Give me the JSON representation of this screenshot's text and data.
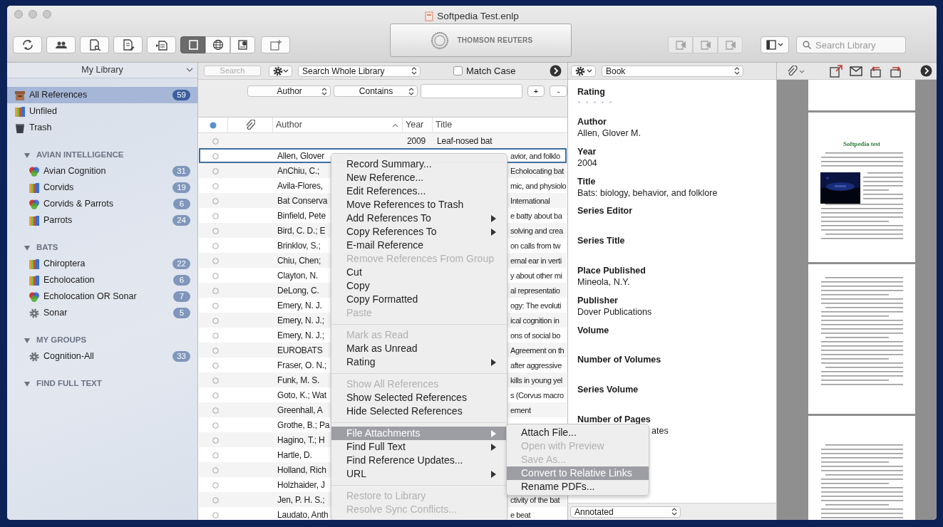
{
  "window": {
    "title": "Softpedia Test.enlp"
  },
  "toolbar": {
    "layout_modes": [
      {
        "selected": true
      },
      {
        "selected": false
      },
      {
        "selected": false
      }
    ],
    "sync_group": {
      "disabled": true
    },
    "logo": "THOMSON REUTERS",
    "search": {
      "placeholder": "Search Library"
    }
  },
  "sidebar": {
    "header": "My Library",
    "items": [
      {
        "label": "All References",
        "count": "59",
        "kind": "archive",
        "selected": true
      },
      {
        "label": "Unfiled",
        "kind": "books",
        "selected": false
      },
      {
        "label": "Trash",
        "kind": "trash",
        "selected": false
      }
    ],
    "sections": [
      {
        "title": "AVIAN INTELLIGENCE",
        "expanded": true,
        "items": [
          {
            "label": "Avian Cognition",
            "count": "31",
            "kind": "smart",
            "selected": false
          },
          {
            "label": "Corvids",
            "count": "19",
            "kind": "books",
            "selected": false
          },
          {
            "label": "Corvids & Parrots",
            "count": "6",
            "kind": "smart",
            "selected": false
          },
          {
            "label": "Parrots",
            "count": "24",
            "kind": "books",
            "selected": false
          }
        ]
      },
      {
        "title": "BATS",
        "expanded": true,
        "items": [
          {
            "label": "Chiroptera",
            "count": "22",
            "kind": "books",
            "selected": false
          },
          {
            "label": "Echolocation",
            "count": "6",
            "kind": "books",
            "selected": false
          },
          {
            "label": "Echolocation OR Sonar",
            "count": "7",
            "kind": "smart",
            "selected": false
          },
          {
            "label": "Sonar",
            "count": "5",
            "kind": "gear",
            "selected": false
          }
        ]
      },
      {
        "title": "MY GROUPS",
        "expanded": true,
        "items": [
          {
            "label": "Cognition-All",
            "count": "33",
            "kind": "gear",
            "selected": false
          }
        ]
      },
      {
        "title": "FIND FULL TEXT",
        "expanded": true
      }
    ]
  },
  "search_panel": {
    "search": {
      "placeholder": "Search"
    },
    "scope": "Search Whole Library",
    "match_case": {
      "label": "Match Case",
      "checked": false
    },
    "filter": {
      "field": "Author",
      "operator": "Contains",
      "add": "+",
      "remove": "-"
    }
  },
  "table": {
    "columns": [
      "Author",
      "Year",
      "Title"
    ],
    "rows": [
      {
        "author": "",
        "year": "2009",
        "title": "Leaf-nosed bat",
        "unread": false,
        "selected": false
      },
      {
        "author": "Allen, Glover",
        "title": "avior, and folklo",
        "unread": false,
        "selected": true
      },
      {
        "author": "AnChiu, C.;",
        "title": "Echolocating bat",
        "unread": false,
        "selected": false
      },
      {
        "author": "Avila-Flores,",
        "title": "mic, and physiolo",
        "unread": false,
        "selected": false
      },
      {
        "author": "Bat Conserva",
        "title": "International",
        "unread": false,
        "selected": false
      },
      {
        "author": "Binfield, Pete",
        "title": "e batty about ba",
        "unread": false,
        "selected": false
      },
      {
        "author": "Bird, C. D.; E",
        "title": "solving and crea",
        "unread": false,
        "selected": false
      },
      {
        "author": "Brinklov, S.;",
        "title": "on calls from tw",
        "unread": false,
        "selected": false
      },
      {
        "author": "Chiu, Chen;",
        "title": "ernal ear in verti",
        "unread": false,
        "selected": false
      },
      {
        "author": "Clayton, N.",
        "title": "y about other mi",
        "unread": false,
        "selected": false
      },
      {
        "author": "DeLong, C.",
        "title": "al representatio",
        "unread": false,
        "selected": false
      },
      {
        "author": "Emery, N. J.",
        "title": "ogy: The evoluti",
        "unread": false,
        "selected": false
      },
      {
        "author": "Emery, N. J.;",
        "title": "ical cognition in",
        "unread": false,
        "selected": false
      },
      {
        "author": "Emery, N. J.;",
        "title": "ons of social bo",
        "unread": false,
        "selected": false
      },
      {
        "author": "EUROBATS",
        "title": "Agreement on th",
        "unread": false,
        "selected": false
      },
      {
        "author": "Fraser, O. N.;",
        "title": "after aggressive",
        "unread": false,
        "selected": false
      },
      {
        "author": "Funk, M. S.",
        "title": "kills in young yel",
        "unread": false,
        "selected": false
      },
      {
        "author": "Goto, K.; Wat",
        "title": "s (Corvus macro",
        "unread": false,
        "selected": false
      },
      {
        "author": "Greenhall, A",
        "title": "ement",
        "unread": false,
        "selected": false
      },
      {
        "author": "Grothe, B.; Pa",
        "unread": false,
        "selected": false
      },
      {
        "author": "Hagino, T.; H",
        "unread": false,
        "selected": false
      },
      {
        "author": "Hartle, D.",
        "unread": false,
        "selected": false
      },
      {
        "author": "Holland, Rich",
        "unread": false,
        "selected": false
      },
      {
        "author": "Holzhaider, J",
        "unread": false,
        "selected": false
      },
      {
        "author": "Jen, P. H. S.;",
        "title": "ctivity of the bat",
        "unread": false,
        "selected": false
      },
      {
        "author": "Laudato, Anth",
        "title": "e beat",
        "unread": false,
        "selected": false
      }
    ]
  },
  "context_menu": {
    "groups": [
      [
        {
          "label": "Record Summary...",
          "disabled": false,
          "submenu": false,
          "selected": false
        },
        {
          "label": "New Reference...",
          "disabled": false,
          "submenu": false,
          "selected": false
        },
        {
          "label": "Edit References...",
          "disabled": false,
          "submenu": false,
          "selected": false
        },
        {
          "label": "Move References to Trash",
          "disabled": false,
          "submenu": false,
          "selected": false
        },
        {
          "label": "Add References To",
          "disabled": false,
          "submenu": true,
          "selected": false
        },
        {
          "label": "Copy References To",
          "disabled": false,
          "submenu": true,
          "selected": false
        },
        {
          "label": "E-mail Reference",
          "disabled": false,
          "submenu": false,
          "selected": false
        },
        {
          "label": "Remove References From Group",
          "disabled": true,
          "submenu": false,
          "selected": false
        },
        {
          "label": "Cut",
          "disabled": false,
          "submenu": false,
          "selected": false
        },
        {
          "label": "Copy",
          "disabled": false,
          "submenu": false,
          "selected": false
        },
        {
          "label": "Copy Formatted",
          "disabled": false,
          "submenu": false,
          "selected": false
        },
        {
          "label": "Paste",
          "disabled": true,
          "submenu": false,
          "selected": false
        }
      ],
      [
        {
          "label": "Mark as Read",
          "disabled": true,
          "submenu": false,
          "selected": false
        },
        {
          "label": "Mark as Unread",
          "disabled": false,
          "submenu": false,
          "selected": false
        },
        {
          "label": "Rating",
          "disabled": false,
          "submenu": true,
          "selected": false
        }
      ],
      [
        {
          "label": "Show All References",
          "disabled": true,
          "submenu": false,
          "selected": false
        },
        {
          "label": "Show Selected References",
          "disabled": false,
          "submenu": false,
          "selected": false
        },
        {
          "label": "Hide Selected References",
          "disabled": false,
          "submenu": false,
          "selected": false
        }
      ],
      [
        {
          "label": "File Attachments",
          "disabled": false,
          "submenu": true,
          "selected": true
        },
        {
          "label": "Find Full Text",
          "disabled": false,
          "submenu": true,
          "selected": false
        },
        {
          "label": "Find Reference Updates...",
          "disabled": false,
          "submenu": false,
          "selected": false
        },
        {
          "label": "URL",
          "disabled": false,
          "submenu": true,
          "selected": false
        }
      ],
      [
        {
          "label": "Restore to Library",
          "disabled": true,
          "submenu": false,
          "selected": false
        },
        {
          "label": "Resolve Sync Conflicts...",
          "disabled": true,
          "submenu": false,
          "selected": false
        }
      ]
    ]
  },
  "submenu": {
    "items": [
      {
        "label": "Attach File...",
        "disabled": false,
        "selected": false
      },
      {
        "label": "Open with Preview",
        "disabled": true,
        "selected": false
      },
      {
        "label": "Save As...",
        "disabled": true,
        "selected": false
      },
      {
        "label": "Convert to Relative Links",
        "disabled": false,
        "selected": true
      },
      {
        "label": "Rename PDFs...",
        "disabled": false,
        "selected": false
      }
    ]
  },
  "detail": {
    "reference_type": "Book",
    "rating": {
      "label": "Rating",
      "stars": 0
    },
    "fields": [
      {
        "label": "Author",
        "value": "Allen, Glover M."
      },
      {
        "label": "Year",
        "value": "2004"
      },
      {
        "label": "Title",
        "value": "Bats: biology, behavior, and folklore"
      },
      {
        "label": "Series Editor"
      },
      {
        "label": "Series Title"
      },
      {
        "label": "Place Published",
        "value": "Mineola, N.Y."
      },
      {
        "label": "Publisher",
        "value": "Dover Publications"
      },
      {
        "label": "Volume"
      },
      {
        "label": "Number of Volumes"
      },
      {
        "label": "Series Volume"
      },
      {
        "label": "Number of Pages",
        "value": "ates",
        "covered": true
      }
    ],
    "footer": "Annotated"
  },
  "pdf": {
    "heading": "Softpedia test"
  }
}
